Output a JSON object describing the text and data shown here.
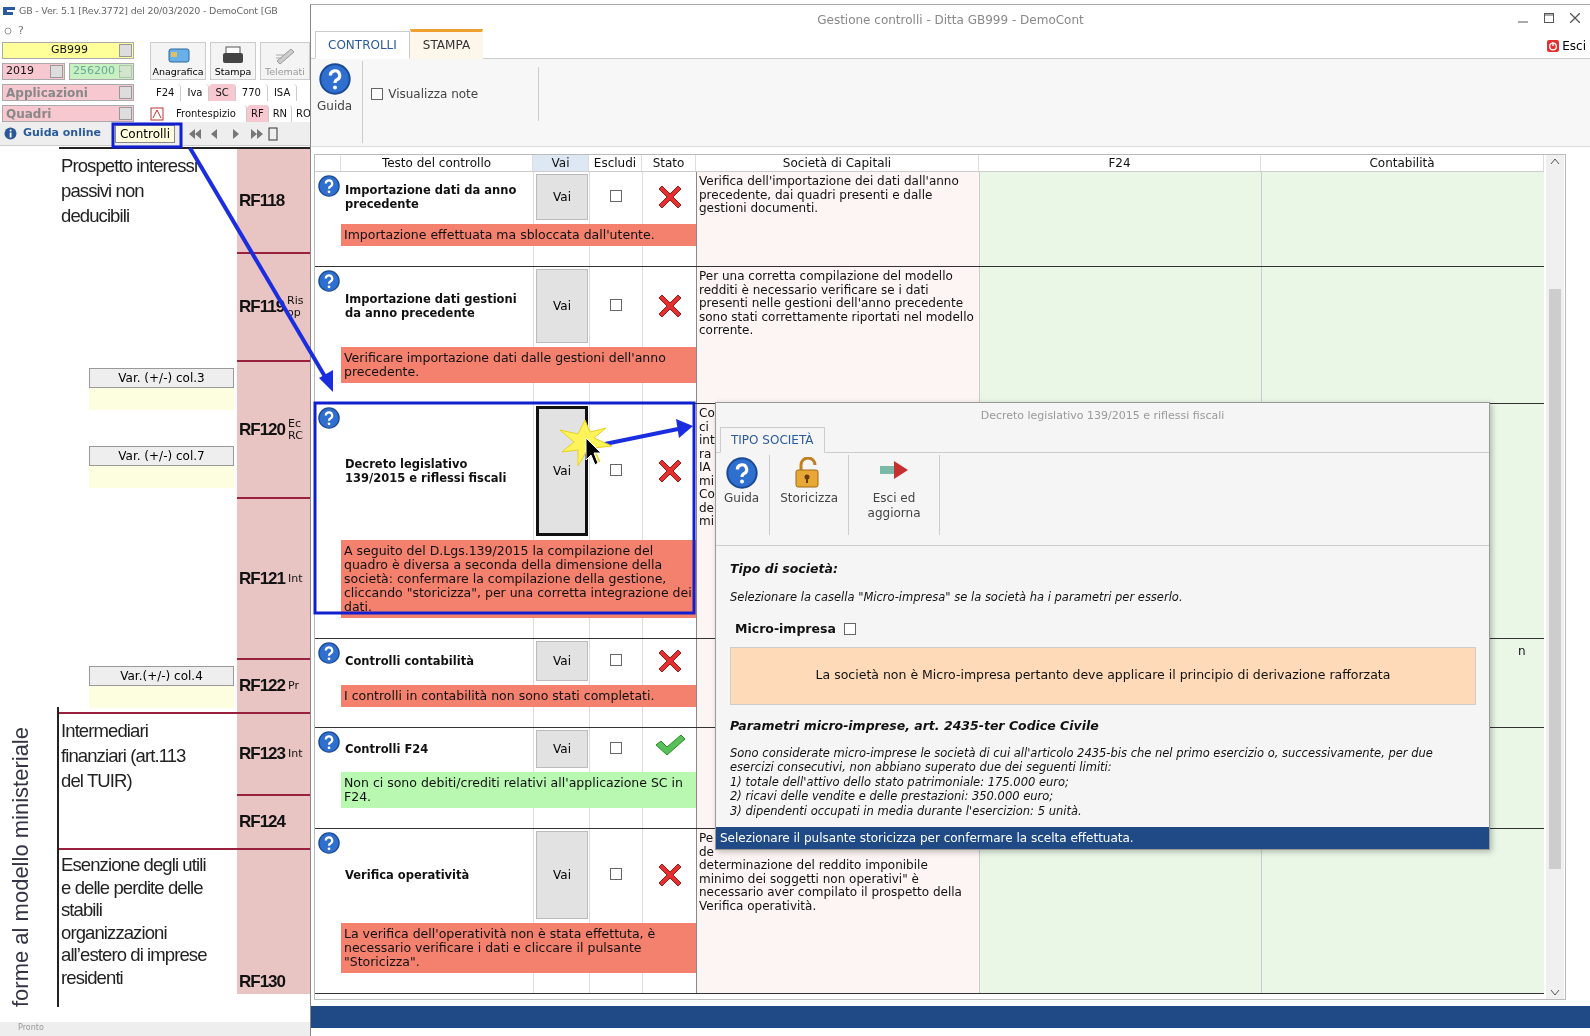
{
  "app": {
    "title": "GB - Ver. 5.1 [Rev.3772] del 20/03/2020 -  DemoCont [GB",
    "menu": [
      "?"
    ],
    "selectors": [
      {
        "value": "GB999",
        "color": "#ffff99",
        "disabled": false
      },
      {
        "value": "2019",
        "color": "#f8c8d0",
        "disabled": false
      },
      {
        "value": "256200 -",
        "color": "#c8f0c0",
        "disabled": true
      },
      {
        "value": "Applicazioni",
        "color": "#f8c8d0",
        "disabled": false
      },
      {
        "value": "Quadri",
        "color": "#f8c8d0",
        "disabled": false
      }
    ],
    "toolbar": [
      {
        "label": "Anagrafica",
        "kind": "card",
        "disabled": false
      },
      {
        "label": "Stampa",
        "kind": "printer",
        "disabled": false
      },
      {
        "label": "Telemati",
        "kind": "pen",
        "disabled": true
      }
    ],
    "tabs": [
      {
        "label": "F24",
        "selected": false
      },
      {
        "label": "Iva",
        "selected": false
      },
      {
        "label": "SC",
        "selected": true
      },
      {
        "label": "770",
        "selected": false
      },
      {
        "label": "ISA",
        "selected": false
      }
    ],
    "sub_tabs": [
      {
        "label": "Frontespizio",
        "selected": false
      },
      {
        "label": "RF",
        "selected": true
      },
      {
        "label": "RN",
        "selected": false
      },
      {
        "label": "RO",
        "selected": false
      }
    ],
    "guide_link": "Guida online",
    "controls_button": "Controlli",
    "form": {
      "vertical_label": "forme al modello ministeriale",
      "rows": [
        {
          "code": "RF118",
          "section": "Prospetto interessi passivi non deducibili",
          "cut": [],
          "fields": []
        },
        {
          "code": "RF119",
          "cut": [
            "Ris",
            "op"
          ],
          "fields": []
        },
        {
          "code": "RF120",
          "cut": [
            "Ec",
            "RC"
          ],
          "fields": [
            "Var. (+/-) col.3",
            "Var. (+/-) col.7"
          ]
        },
        {
          "code": "RF121",
          "cut": [
            "Int"
          ],
          "fields": []
        },
        {
          "code": "RF122",
          "cut": [
            "Pr"
          ],
          "fields": [
            "Var.(+/-) col.4"
          ]
        },
        {
          "code": "RF123",
          "section": "Intermediari finanziari (art.113 del TUIR)",
          "cut": [
            "Int"
          ],
          "fields": []
        },
        {
          "code": "RF124",
          "cut": [],
          "fields": []
        },
        {
          "code": "RF130",
          "section": "Esenzione degli utili e delle perdite delle stabili organizzazioni all’estero di imprese residenti",
          "cut": [],
          "fields": []
        }
      ]
    },
    "status_bar": "Pronto"
  },
  "window": {
    "title": "Gestione controlli - Ditta GB999 - DemoCont",
    "exit": "Esci",
    "tabs": [
      {
        "label": "CONTROLLI",
        "selected": true
      },
      {
        "label": "STAMPA",
        "selected": false
      }
    ],
    "ribbon": {
      "help": "Guida",
      "notes": {
        "label": "Visualizza note",
        "checked": false
      }
    },
    "table": {
      "columns": [
        "Testo del controllo",
        "Vai",
        "Escludi",
        "Stato",
        "Società di Capitali",
        "F24",
        "Contabilità"
      ],
      "rows": [
        {
          "title": "Importazione dati da anno precedente",
          "button": "Vai",
          "pressed": false,
          "excluded": false,
          "kind": "error",
          "message": "Importazione effettuata ma sbloccata dall'utente.",
          "societa": "Verifica dell'importazione dei dati dall'anno precedente, dai quadri presenti e dalle gestioni documenti."
        },
        {
          "title": "Importazione dati gestioni da anno precedente",
          "button": "Vai",
          "pressed": false,
          "excluded": false,
          "kind": "error",
          "message": "Verificare importazione dati dalle gestioni dell'anno precedente.",
          "societa": "Per una corretta compilazione del modello redditi è necessario verificare se i dati presenti nelle gestioni dell'anno precedente sono stati correttamente riportati nel modello corrente."
        },
        {
          "title": "Decreto legislativo 139/2015 e riflessi fiscali",
          "button": "Vai",
          "pressed": true,
          "excluded": false,
          "kind": "error",
          "message": "A seguito del D.Lgs.139/2015 la compilazione del quadro è diversa a seconda della dimensione della società: confermare la compilazione della gestione, cliccando \"storicizza\", per una corretta integrazione dei dati.",
          "societa": "Co\nci\nint\nra\nIA\nmi\nCo\nde\nmi"
        },
        {
          "title": "Controlli contabilità",
          "button": "Vai",
          "pressed": false,
          "excluded": false,
          "kind": "error",
          "message": "I controlli in contabilità non sono stati completati.",
          "contabilita": "n"
        },
        {
          "title": "Controlli F24",
          "button": "Vai",
          "pressed": false,
          "excluded": false,
          "kind": "ok",
          "message": "Non ci sono debiti/crediti relativi all'applicazione SC in F24."
        },
        {
          "title": "Verifica operatività",
          "button": "Vai",
          "pressed": false,
          "excluded": false,
          "kind": "error",
          "message": "La verifica dell'operatività non è stata effettuta, è necessario verificare i dati e cliccare il pulsante \"Storicizza\".",
          "societa": "Pe\nde\ndeterminazione del reddito imponibile\nminimo dei soggetti non operativi\" è\nnecessario aver compilato il prospetto della\nVerifica operatività."
        }
      ]
    }
  },
  "popup": {
    "title": "Decreto legislativo 139/2015 e riflessi fiscali",
    "tabs": [
      {
        "label": "TIPO SOCIETÀ",
        "selected": true
      }
    ],
    "buttons": [
      {
        "label": "Guida",
        "kind": "help"
      },
      {
        "label": "Storicizza",
        "kind": "lock"
      },
      {
        "label": "Esci ed aggiorna",
        "kind": "exit"
      }
    ],
    "heading": "Tipo di società:",
    "hint": "Selezionare la casella  \"Micro-impresa\"  se la società ha i parametri per esserlo.",
    "micro": {
      "label": "Micro-impresa",
      "checked": false
    },
    "notice": "La società non è Micro-impresa pertanto deve applicare il principio di derivazione rafforzata",
    "params_heading": "Parametri micro-imprese, art. 2435-ter Codice Civile",
    "params": [
      "Sono considerate micro-imprese le società di cui all'articolo 2435-bis che nel primo esercizio o, successivamente, per due esercizi consecutivi, non abbiano superato due dei seguenti limiti:",
      "1) totale dell'attivo dello stato patrimoniale: 175.000 euro;",
      "2) ricavi delle vendite e delle prestazioni: 350.000 euro;",
      "3) dipendenti occupati in media durante l'esercizion: 5 unità."
    ],
    "status": "Selezionare il pulsante storicizza per confermare la scelta effettuata."
  }
}
